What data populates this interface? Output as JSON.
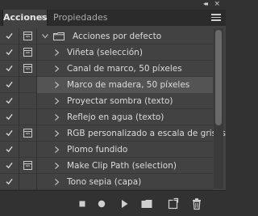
{
  "window": {
    "collapse_glyph": "◂◂",
    "close_glyph": "×"
  },
  "tabs": [
    {
      "label": "Acciones",
      "active": true,
      "close_glyph": "×"
    },
    {
      "label": "Propiedades",
      "active": false
    }
  ],
  "actions": {
    "set": {
      "label": "Acciones por defecto",
      "enabled": true,
      "dialog": true,
      "expanded": true
    },
    "items": [
      {
        "label": "Viñeta (selección)",
        "enabled": true,
        "dialog": true,
        "selected": false
      },
      {
        "label": "Canal de marco, 50 píxeles",
        "enabled": true,
        "dialog": true,
        "selected": false
      },
      {
        "label": "Marco de madera, 50 píxeles",
        "enabled": true,
        "dialog": false,
        "selected": true
      },
      {
        "label": "Proyectar sombra (texto)",
        "enabled": true,
        "dialog": false,
        "selected": false
      },
      {
        "label": "Reflejo en agua (texto)",
        "enabled": true,
        "dialog": false,
        "selected": false
      },
      {
        "label": "RGB personalizado a escala de grises",
        "enabled": true,
        "dialog": true,
        "selected": false
      },
      {
        "label": "Plomo fundido",
        "enabled": true,
        "dialog": false,
        "selected": false
      },
      {
        "label": "Make Clip Path (selection)",
        "enabled": true,
        "dialog": true,
        "selected": false
      },
      {
        "label": "Tono sepia (capa)",
        "enabled": true,
        "dialog": false,
        "selected": false
      }
    ]
  },
  "toolbar": {
    "buttons": [
      "stop-icon",
      "record-icon",
      "play-icon",
      "new-set-icon",
      "new-action-icon",
      "delete-icon"
    ]
  },
  "colors": {
    "panel": "#424242",
    "selected_row": "#545454",
    "icon": "#d0d0d0"
  }
}
